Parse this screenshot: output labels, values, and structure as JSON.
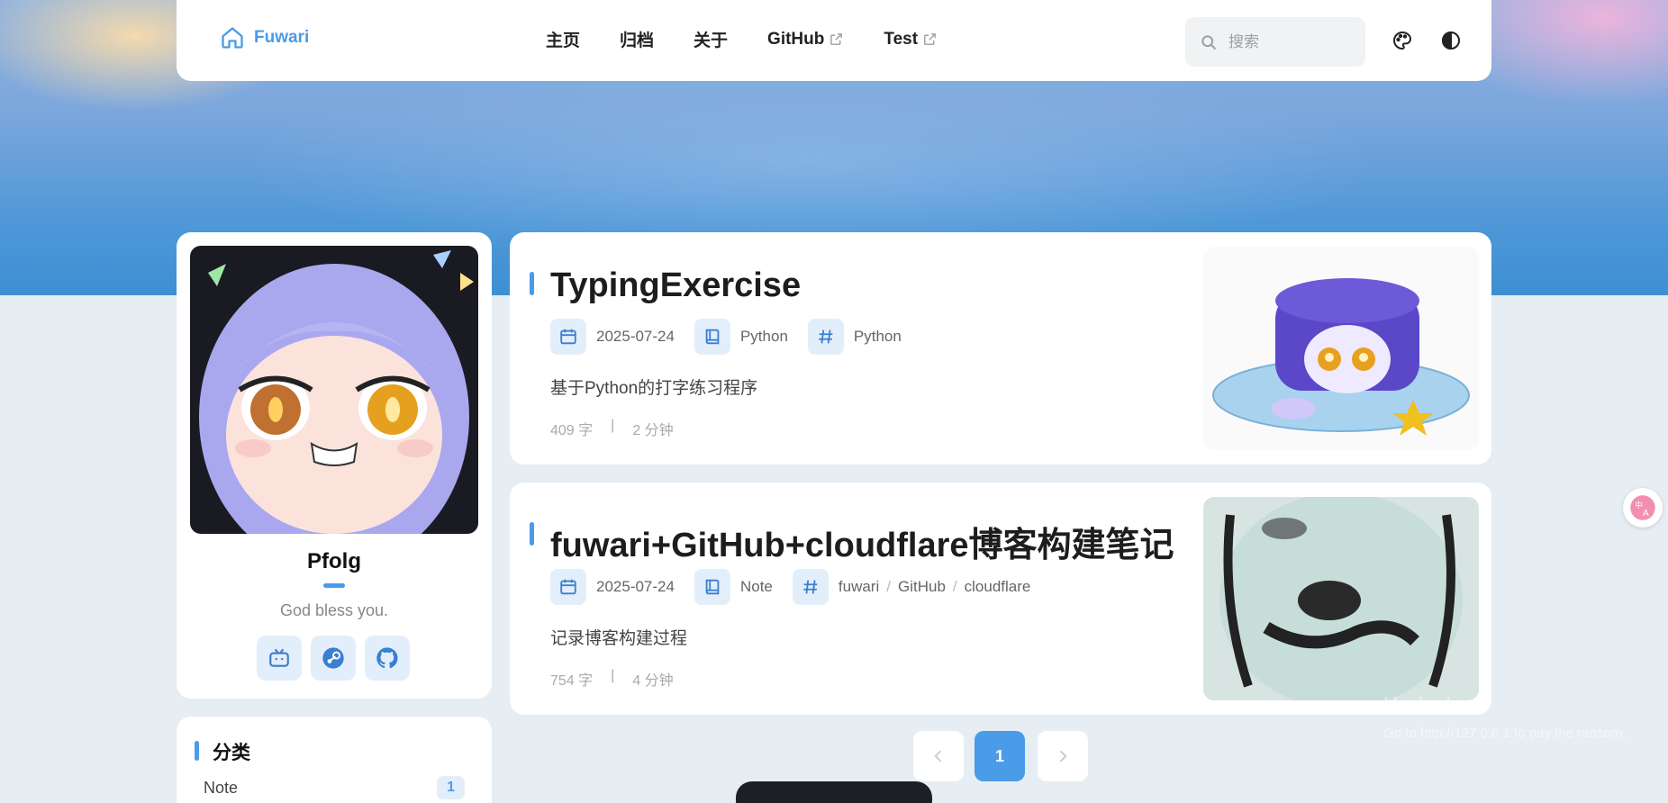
{
  "nav": {
    "brand": "Fuwari",
    "links": [
      {
        "label": "主页",
        "external": false
      },
      {
        "label": "归档",
        "external": false
      },
      {
        "label": "关于",
        "external": false
      },
      {
        "label": "GitHub",
        "external": true
      },
      {
        "label": "Test",
        "external": true
      }
    ],
    "search_placeholder": "搜索",
    "icons": [
      "home-icon",
      "search-icon",
      "palette-icon",
      "contrast-icon"
    ]
  },
  "profile": {
    "name": "Pfolg",
    "bio": "God bless you.",
    "socials": [
      "bilibili-icon",
      "steam-icon",
      "github-icon"
    ]
  },
  "categories": {
    "title": "分类",
    "items": [
      {
        "name": "Note",
        "count": "1"
      }
    ]
  },
  "posts": [
    {
      "title": "TypingExercise",
      "date": "2025-07-24",
      "category": "Python",
      "tags": [
        "Python"
      ],
      "description": "基于Python的打字练习程序",
      "words": "409 字",
      "read_time": "2 分钟"
    },
    {
      "title": "fuwari+GitHub+cloudflare博客构建笔记",
      "date": "2025-07-24",
      "category": "Note",
      "tags": [
        "fuwari",
        "GitHub",
        "cloudflare"
      ],
      "description": "记录博客构建过程",
      "words": "754 字",
      "read_time": "4 分钟"
    }
  ],
  "pagination": {
    "current": "1"
  },
  "watermark": {
    "line1": "Hacked",
    "line2": "Go to http://127.0.0.1 to pay the ransom."
  },
  "colors": {
    "accent": "#4a9be8",
    "background": "#e6edf3"
  }
}
